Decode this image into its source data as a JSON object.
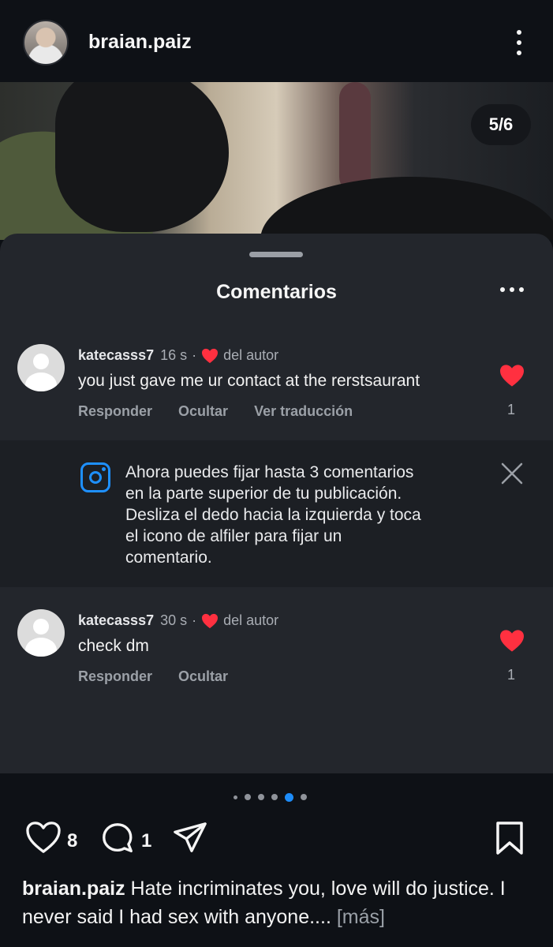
{
  "header": {
    "username": "braian.paiz"
  },
  "photo": {
    "counter": "5/6"
  },
  "comments_sheet": {
    "title": "Comentarios",
    "comments": [
      {
        "username": "katecasss7",
        "time": "16 s",
        "separator": "·",
        "author_like_label": "del autor",
        "text": "you just gave me ur contact at the rerstsaurant",
        "actions": [
          "Responder",
          "Ocultar",
          "Ver traducción"
        ],
        "likes": "1"
      },
      {
        "username": "katecasss7",
        "time": "30 s",
        "separator": "·",
        "author_like_label": "del autor",
        "text": "check dm",
        "actions": [
          "Responder",
          "Ocultar"
        ],
        "likes": "1"
      }
    ],
    "notice": {
      "lines": [
        "Ahora puedes fijar hasta 3 comentarios",
        "en la parte superior de tu publicación.",
        "Desliza el dedo hacia la izquierda y toca",
        "el icono de alfiler para fijar un",
        "comentario."
      ]
    }
  },
  "pager": {
    "count": 6,
    "active_index": 4
  },
  "actions_bar": {
    "like_count": "8",
    "comment_count": "1"
  },
  "caption": {
    "username": "braian.paiz",
    "text": " Hate incriminates you, love will do justice. I never said I had sex with anyone....",
    "more": " [más]"
  },
  "colors": {
    "like_red": "#ff3040",
    "accent_blue": "#1d8cf8"
  },
  "icons": [
    "kebab-icon",
    "more-dots-icon",
    "heart-icon",
    "instagram-icon",
    "close-icon",
    "comment-icon",
    "share-icon",
    "bookmark-icon"
  ]
}
